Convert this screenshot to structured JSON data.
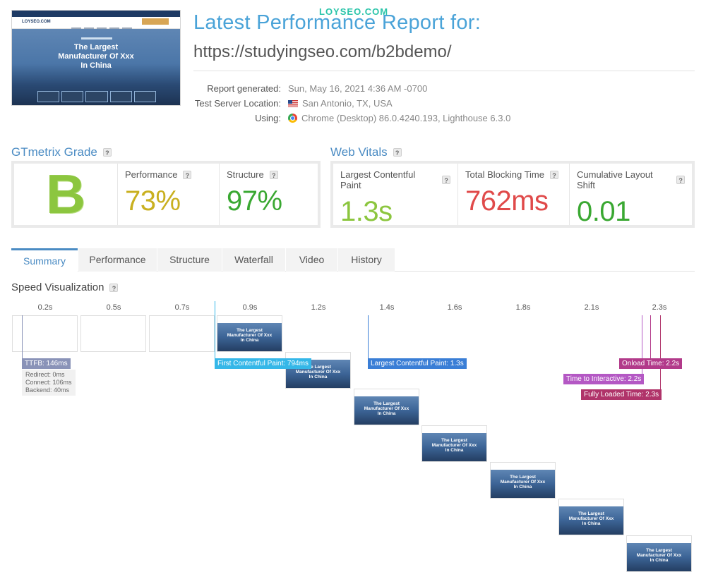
{
  "thumbnail": {
    "logo": "LOYSEO.COM",
    "headline_line1": "The Largest",
    "headline_line2": "Manufacturer Of Xxx",
    "headline_line3": "In China"
  },
  "header": {
    "title": "Latest Performance Report for:",
    "watermark": "LOYSEO.COM",
    "url": "https://studyingseo.com/b2bdemo/"
  },
  "meta": {
    "generated_label": "Report generated:",
    "generated_value": "Sun, May 16, 2021 4:36 AM -0700",
    "location_label": "Test Server Location:",
    "location_value": "San Antonio, TX, USA",
    "using_label": "Using:",
    "using_value": "Chrome (Desktop) 86.0.4240.193, Lighthouse 6.3.0"
  },
  "gtmetrix": {
    "title": "GTmetrix Grade",
    "grade": "B",
    "performance_label": "Performance",
    "performance_value": "73%",
    "structure_label": "Structure",
    "structure_value": "97%"
  },
  "web_vitals": {
    "title": "Web Vitals",
    "lcp_label": "Largest Contentful Paint",
    "lcp_value": "1.3s",
    "tbt_label": "Total Blocking Time",
    "tbt_value": "762ms",
    "cls_label": "Cumulative Layout Shift",
    "cls_value": "0.01"
  },
  "colors": {
    "grade": "#8cc63f",
    "performance": "#c9b020",
    "structure": "#3aa832",
    "lcp": "#8cc63f",
    "tbt": "#e04a4a",
    "cls": "#3aa832"
  },
  "tabs": {
    "summary": "Summary",
    "performance": "Performance",
    "structure": "Structure",
    "waterfall": "Waterfall",
    "video": "Video",
    "history": "History"
  },
  "speed": {
    "title": "Speed Visualization",
    "times": [
      "0.2s",
      "0.5s",
      "0.7s",
      "0.9s",
      "1.2s",
      "1.4s",
      "1.6s",
      "1.8s",
      "2.1s",
      "2.3s"
    ],
    "frame_text_1": "The Largest",
    "frame_text_2": "Manufacturer Of Xxx",
    "frame_text_3": "In China",
    "ttfb": "TTFB: 146ms",
    "redirect": "Redirect: 0ms",
    "connect": "Connect: 106ms",
    "backend": "Backend: 40ms",
    "fcp": "First Contentful Paint: 794ms",
    "lcp": "Largest Contentful Paint: 1.3s",
    "tti": "Time to Interactive: 2.2s",
    "onload": "Onload Time: 2.2s",
    "fully_loaded": "Fully Loaded Time: 2.3s"
  }
}
